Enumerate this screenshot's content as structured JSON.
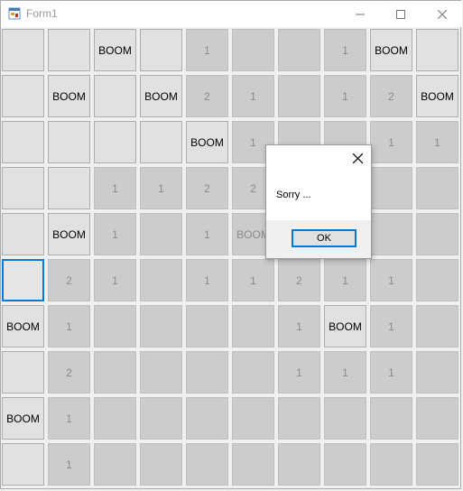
{
  "window": {
    "title": "Form1"
  },
  "board": {
    "rows": [
      [
        {
          "s": "u",
          "t": ""
        },
        {
          "s": "u",
          "t": ""
        },
        {
          "s": "u",
          "t": "BOOM"
        },
        {
          "s": "u",
          "t": ""
        },
        {
          "s": "r",
          "t": "1"
        },
        {
          "s": "r",
          "t": ""
        },
        {
          "s": "r",
          "t": ""
        },
        {
          "s": "r",
          "t": "1"
        },
        {
          "s": "u",
          "t": "BOOM"
        },
        {
          "s": "u",
          "t": ""
        }
      ],
      [
        {
          "s": "u",
          "t": ""
        },
        {
          "s": "u",
          "t": "BOOM"
        },
        {
          "s": "u",
          "t": ""
        },
        {
          "s": "u",
          "t": "BOOM"
        },
        {
          "s": "r",
          "t": "2"
        },
        {
          "s": "r",
          "t": "1"
        },
        {
          "s": "r",
          "t": ""
        },
        {
          "s": "r",
          "t": "1"
        },
        {
          "s": "r",
          "t": "2"
        },
        {
          "s": "u",
          "t": "BOOM"
        }
      ],
      [
        {
          "s": "u",
          "t": ""
        },
        {
          "s": "u",
          "t": ""
        },
        {
          "s": "u",
          "t": ""
        },
        {
          "s": "u",
          "t": ""
        },
        {
          "s": "u",
          "t": "BOOM"
        },
        {
          "s": "r",
          "t": "1"
        },
        {
          "s": "r",
          "t": ""
        },
        {
          "s": "r",
          "t": ""
        },
        {
          "s": "r",
          "t": "1"
        },
        {
          "s": "r",
          "t": "1"
        }
      ],
      [
        {
          "s": "u",
          "t": ""
        },
        {
          "s": "u",
          "t": ""
        },
        {
          "s": "r",
          "t": "1"
        },
        {
          "s": "r",
          "t": "1"
        },
        {
          "s": "r",
          "t": "2"
        },
        {
          "s": "r",
          "t": "2"
        },
        {
          "s": "r",
          "t": ""
        },
        {
          "s": "r",
          "t": ""
        },
        {
          "s": "r",
          "t": ""
        },
        {
          "s": "r",
          "t": ""
        }
      ],
      [
        {
          "s": "u",
          "t": ""
        },
        {
          "s": "u",
          "t": "BOOM"
        },
        {
          "s": "r",
          "t": "1"
        },
        {
          "s": "r",
          "t": ""
        },
        {
          "s": "r",
          "t": "1"
        },
        {
          "s": "r",
          "t": "BOOM"
        },
        {
          "s": "r",
          "t": ""
        },
        {
          "s": "r",
          "t": ""
        },
        {
          "s": "r",
          "t": ""
        },
        {
          "s": "r",
          "t": ""
        }
      ],
      [
        {
          "s": "f",
          "t": ""
        },
        {
          "s": "r",
          "t": "2"
        },
        {
          "s": "r",
          "t": "1"
        },
        {
          "s": "r",
          "t": ""
        },
        {
          "s": "r",
          "t": "1"
        },
        {
          "s": "r",
          "t": "1"
        },
        {
          "s": "r",
          "t": "2"
        },
        {
          "s": "r",
          "t": "1"
        },
        {
          "s": "r",
          "t": "1"
        },
        {
          "s": "r",
          "t": ""
        }
      ],
      [
        {
          "s": "u",
          "t": "BOOM"
        },
        {
          "s": "r",
          "t": "1"
        },
        {
          "s": "r",
          "t": ""
        },
        {
          "s": "r",
          "t": ""
        },
        {
          "s": "r",
          "t": ""
        },
        {
          "s": "r",
          "t": ""
        },
        {
          "s": "r",
          "t": "1"
        },
        {
          "s": "u",
          "t": "BOOM"
        },
        {
          "s": "r",
          "t": "1"
        },
        {
          "s": "r",
          "t": ""
        }
      ],
      [
        {
          "s": "u",
          "t": ""
        },
        {
          "s": "r",
          "t": "2"
        },
        {
          "s": "r",
          "t": ""
        },
        {
          "s": "r",
          "t": ""
        },
        {
          "s": "r",
          "t": ""
        },
        {
          "s": "r",
          "t": ""
        },
        {
          "s": "r",
          "t": "1"
        },
        {
          "s": "r",
          "t": "1"
        },
        {
          "s": "r",
          "t": "1"
        },
        {
          "s": "r",
          "t": ""
        }
      ],
      [
        {
          "s": "u",
          "t": "BOOM"
        },
        {
          "s": "r",
          "t": "1"
        },
        {
          "s": "r",
          "t": ""
        },
        {
          "s": "r",
          "t": ""
        },
        {
          "s": "r",
          "t": ""
        },
        {
          "s": "r",
          "t": ""
        },
        {
          "s": "r",
          "t": ""
        },
        {
          "s": "r",
          "t": ""
        },
        {
          "s": "r",
          "t": ""
        },
        {
          "s": "r",
          "t": ""
        }
      ],
      [
        {
          "s": "u",
          "t": ""
        },
        {
          "s": "r",
          "t": "1"
        },
        {
          "s": "r",
          "t": ""
        },
        {
          "s": "r",
          "t": ""
        },
        {
          "s": "r",
          "t": ""
        },
        {
          "s": "r",
          "t": ""
        },
        {
          "s": "r",
          "t": ""
        },
        {
          "s": "r",
          "t": ""
        },
        {
          "s": "r",
          "t": ""
        },
        {
          "s": "r",
          "t": ""
        }
      ]
    ]
  },
  "dialog": {
    "message": "Sorry ...",
    "ok_label": "OK"
  },
  "colors": {
    "accent": "#0078d7",
    "unrevealed": "#e1e1e1",
    "revealed": "#cccccc"
  }
}
